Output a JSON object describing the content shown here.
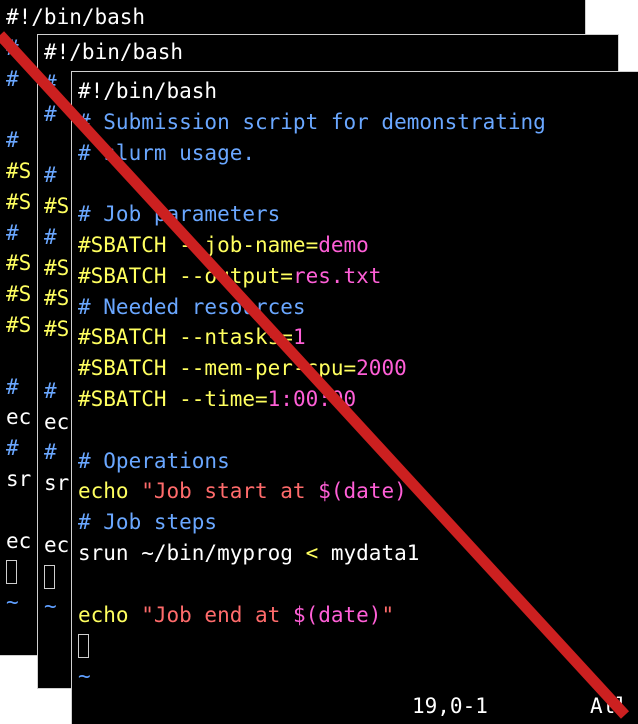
{
  "back_terminal": {
    "lines": [
      {
        "segments": [
          {
            "text": "#!/bin/bash",
            "cls": "c-shebang"
          }
        ]
      },
      {
        "segments": [
          {
            "text": "#",
            "cls": "c-comment"
          }
        ]
      },
      {
        "segments": [
          {
            "text": "#",
            "cls": "c-comment"
          }
        ]
      },
      {
        "segments": [
          {
            "text": "",
            "cls": "c-plain"
          }
        ]
      },
      {
        "segments": [
          {
            "text": "#",
            "cls": "c-comment"
          }
        ]
      },
      {
        "segments": [
          {
            "text": "#S",
            "cls": "c-directive"
          }
        ]
      },
      {
        "segments": [
          {
            "text": "#S",
            "cls": "c-directive"
          }
        ]
      },
      {
        "segments": [
          {
            "text": "#",
            "cls": "c-comment"
          }
        ]
      },
      {
        "segments": [
          {
            "text": "#S",
            "cls": "c-directive"
          }
        ]
      },
      {
        "segments": [
          {
            "text": "#S",
            "cls": "c-directive"
          }
        ]
      },
      {
        "segments": [
          {
            "text": "#S",
            "cls": "c-directive"
          }
        ]
      },
      {
        "segments": [
          {
            "text": "",
            "cls": "c-plain"
          }
        ]
      },
      {
        "segments": [
          {
            "text": "#",
            "cls": "c-comment"
          }
        ]
      },
      {
        "segments": [
          {
            "text": "ec",
            "cls": "c-plain"
          }
        ]
      },
      {
        "segments": [
          {
            "text": "#",
            "cls": "c-comment"
          }
        ]
      },
      {
        "segments": [
          {
            "text": "sr",
            "cls": "c-plain"
          }
        ]
      },
      {
        "segments": [
          {
            "text": "",
            "cls": "c-plain"
          }
        ]
      },
      {
        "segments": [
          {
            "text": "ec",
            "cls": "c-plain"
          }
        ]
      },
      {
        "segments": [
          {
            "text": "",
            "cls": "cursor"
          }
        ]
      },
      {
        "segments": [
          {
            "text": "~",
            "cls": "c-tilde"
          }
        ]
      }
    ]
  },
  "middle_terminal": {
    "lines": [
      {
        "segments": [
          {
            "text": "#!/bin/bash",
            "cls": "c-shebang"
          }
        ]
      },
      {
        "segments": [
          {
            "text": "#",
            "cls": "c-comment"
          }
        ]
      },
      {
        "segments": [
          {
            "text": "#",
            "cls": "c-comment"
          }
        ]
      },
      {
        "segments": [
          {
            "text": "",
            "cls": "c-plain"
          }
        ]
      },
      {
        "segments": [
          {
            "text": "#",
            "cls": "c-comment"
          }
        ]
      },
      {
        "segments": [
          {
            "text": "#S",
            "cls": "c-directive"
          }
        ]
      },
      {
        "segments": [
          {
            "text": "#",
            "cls": "c-comment"
          }
        ]
      },
      {
        "segments": [
          {
            "text": "#S",
            "cls": "c-directive"
          }
        ]
      },
      {
        "segments": [
          {
            "text": "#S",
            "cls": "c-directive"
          }
        ]
      },
      {
        "segments": [
          {
            "text": "#S",
            "cls": "c-directive"
          }
        ]
      },
      {
        "segments": [
          {
            "text": "",
            "cls": "c-plain"
          }
        ]
      },
      {
        "segments": [
          {
            "text": "#",
            "cls": "c-comment"
          }
        ]
      },
      {
        "segments": [
          {
            "text": "ec",
            "cls": "c-plain"
          }
        ]
      },
      {
        "segments": [
          {
            "text": "#",
            "cls": "c-comment"
          }
        ]
      },
      {
        "segments": [
          {
            "text": "sr",
            "cls": "c-plain"
          }
        ]
      },
      {
        "segments": [
          {
            "text": "",
            "cls": "c-plain"
          }
        ]
      },
      {
        "segments": [
          {
            "text": "ec",
            "cls": "c-plain"
          }
        ]
      },
      {
        "segments": [
          {
            "text": "",
            "cls": "cursor"
          }
        ]
      },
      {
        "segments": [
          {
            "text": "~",
            "cls": "c-tilde"
          }
        ]
      }
    ]
  },
  "front_terminal": {
    "lines": [
      {
        "segments": [
          {
            "text": "#!/bin/bash",
            "cls": "c-shebang"
          }
        ]
      },
      {
        "segments": [
          {
            "text": "# Submission script for demonstrating",
            "cls": "c-comment"
          }
        ]
      },
      {
        "segments": [
          {
            "text": "# slurm usage.",
            "cls": "c-comment"
          }
        ]
      },
      {
        "segments": [
          {
            "text": "",
            "cls": "c-plain"
          }
        ]
      },
      {
        "segments": [
          {
            "text": "# Job parameters",
            "cls": "c-comment"
          }
        ]
      },
      {
        "segments": [
          {
            "text": "#SBATCH --job-name=",
            "cls": "c-directive"
          },
          {
            "text": "demo",
            "cls": "c-value"
          }
        ]
      },
      {
        "segments": [
          {
            "text": "#SBATCH --output=",
            "cls": "c-directive"
          },
          {
            "text": "res.txt",
            "cls": "c-value"
          }
        ]
      },
      {
        "segments": [
          {
            "text": "# Needed resources",
            "cls": "c-comment"
          }
        ]
      },
      {
        "segments": [
          {
            "text": "#SBATCH --ntasks=",
            "cls": "c-directive"
          },
          {
            "text": "1",
            "cls": "c-value"
          }
        ]
      },
      {
        "segments": [
          {
            "text": "#SBATCH --mem-per-cpu=",
            "cls": "c-directive"
          },
          {
            "text": "2000",
            "cls": "c-value"
          }
        ]
      },
      {
        "segments": [
          {
            "text": "#SBATCH --time=",
            "cls": "c-directive"
          },
          {
            "text": "1:00:00",
            "cls": "c-value"
          }
        ]
      },
      {
        "segments": [
          {
            "text": "",
            "cls": "c-plain"
          }
        ]
      },
      {
        "segments": [
          {
            "text": "# Operations",
            "cls": "c-comment"
          }
        ]
      },
      {
        "segments": [
          {
            "text": "echo ",
            "cls": "c-directive"
          },
          {
            "text": "\"Job start at ",
            "cls": "c-string"
          },
          {
            "text": "$(date)",
            "cls": "c-var"
          },
          {
            "text": "\"",
            "cls": "c-string"
          }
        ]
      },
      {
        "segments": [
          {
            "text": "# Job steps",
            "cls": "c-comment"
          }
        ]
      },
      {
        "segments": [
          {
            "text": "srun ~/bin/myprog ",
            "cls": "c-plain"
          },
          {
            "text": "<",
            "cls": "c-directive"
          },
          {
            "text": " mydata1",
            "cls": "c-plain"
          }
        ]
      },
      {
        "segments": [
          {
            "text": "",
            "cls": "c-plain"
          }
        ]
      },
      {
        "segments": [
          {
            "text": "echo ",
            "cls": "c-directive"
          },
          {
            "text": "\"Job end at ",
            "cls": "c-string"
          },
          {
            "text": "$(date)",
            "cls": "c-var"
          },
          {
            "text": "\"",
            "cls": "c-string"
          }
        ]
      },
      {
        "segments": [
          {
            "text": "",
            "cls": "cursor"
          }
        ]
      },
      {
        "segments": [
          {
            "text": "~",
            "cls": "c-tilde"
          }
        ]
      }
    ],
    "status": {
      "position": "19,0-1",
      "scroll": "All"
    }
  },
  "colors": {
    "strike": "#cc2020",
    "background": "#000000"
  }
}
